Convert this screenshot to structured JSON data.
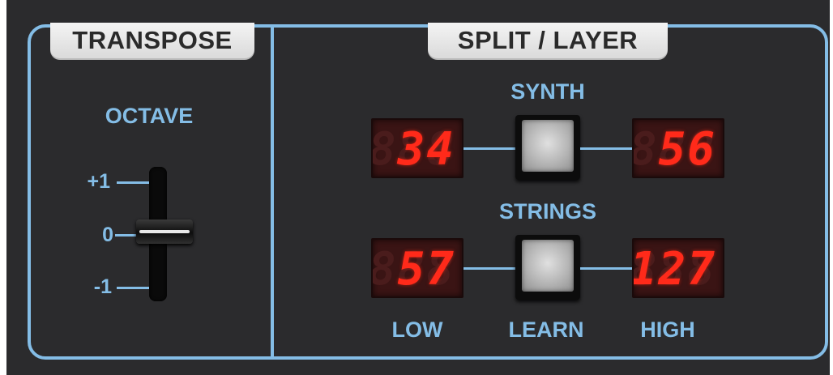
{
  "sections": {
    "transpose_title": "TRANSPOSE",
    "split_layer_title": "SPLIT / LAYER"
  },
  "octave": {
    "label": "OCTAVE",
    "ticks": [
      "+1",
      "0",
      "-1"
    ],
    "value": "0"
  },
  "synth": {
    "label": "SYNTH",
    "low": "34",
    "high": "56"
  },
  "strings": {
    "label": "STRINGS",
    "low": "57",
    "high": "127"
  },
  "footer": {
    "low_label": "LOW",
    "learn_label": "LEARN",
    "high_label": "HIGH"
  },
  "led_ghost_digits": "888",
  "colors": {
    "panel_bg": "#2b2b2d",
    "accent": "#84bde6",
    "led_on": "#ff2a1a"
  }
}
